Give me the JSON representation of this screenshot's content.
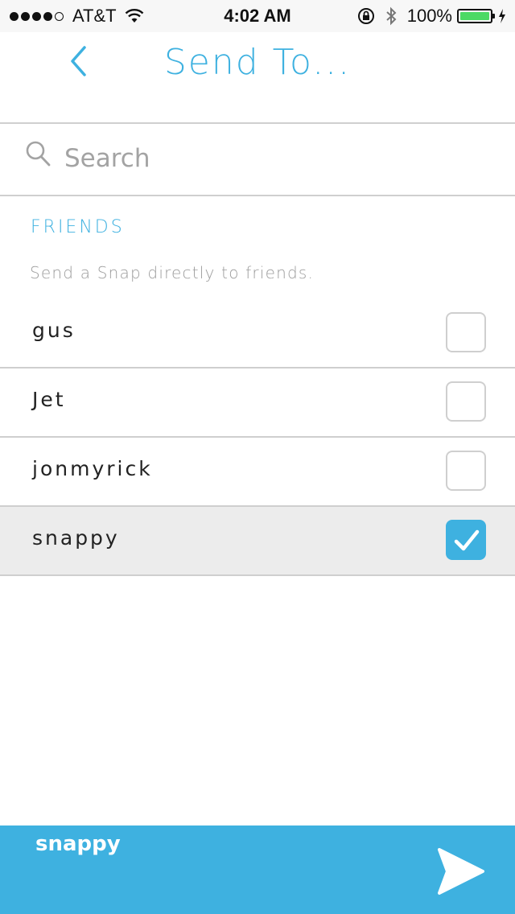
{
  "status_bar": {
    "carrier": "AT&T",
    "time": "4:02 AM",
    "battery": "100%",
    "signal_dots": 5,
    "signal_filled": 4,
    "icons": [
      "wifi-icon",
      "rotation-lock-icon",
      "bluetooth-icon",
      "battery-icon",
      "charging-icon"
    ]
  },
  "header": {
    "title": "Send To...",
    "back_icon": "chevron-left-icon"
  },
  "search": {
    "placeholder": "Search",
    "value": "",
    "icon": "search-icon"
  },
  "friends": {
    "section_title": "FRIENDS",
    "subtitle": "Send a Snap directly to friends.",
    "items": [
      {
        "name": "gus",
        "selected": false
      },
      {
        "name": "Jet",
        "selected": false
      },
      {
        "name": "jonmyrick",
        "selected": false
      },
      {
        "name": "snappy",
        "selected": true
      }
    ]
  },
  "bottom_bar": {
    "recipients": "snappy",
    "send_icon": "send-arrow-icon"
  },
  "colors": {
    "accent": "#3eb1e0",
    "divider": "#cfcfcf",
    "selected_row": "#ececec",
    "battery": "#4cd964"
  }
}
